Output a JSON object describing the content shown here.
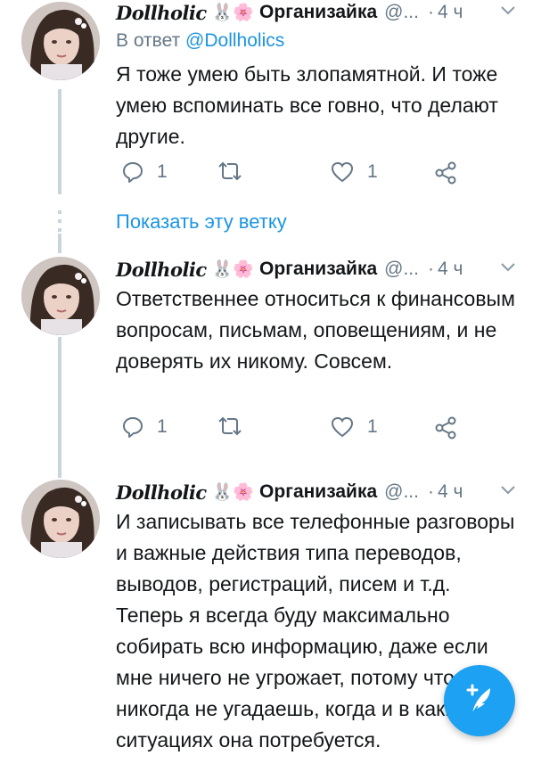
{
  "tweets": [
    {
      "author_name_script": "Dollholic",
      "author_emoji": "🐰🌸",
      "author_name": "Организайка",
      "handle": "@...",
      "dot": "·",
      "time": "4 ч",
      "reply_prefix": "В ответ ",
      "reply_handle": "@Dollholics",
      "text": "Я тоже умею быть злопамятной. И тоже умею вспоминать все говно, что делают другие.",
      "replies": "1",
      "retweets": "",
      "likes": "1"
    },
    {
      "author_name_script": "Dollholic",
      "author_emoji": "🐰🌸",
      "author_name": "Организайка",
      "handle": "@...",
      "dot": "·",
      "time": "4 ч",
      "text": "Ответственнее относиться к финансовым вопросам, письмам, оповещениям, и не доверять их никому. Совсем.",
      "replies": "1",
      "retweets": "",
      "likes": "1"
    },
    {
      "author_name_script": "Dollholic",
      "author_emoji": "🐰🌸",
      "author_name": "Организайка",
      "handle": "@...",
      "dot": "·",
      "time": "4 ч",
      "text": "И записывать все телефонные разговоры и важные действия типа переводов, выводов, регистраций, писем и т.д. Теперь я всегда буду максимально собирать всю информацию, даже если мне ничего не угрожает, потому что никогда не угадаешь, когда и в каких ситуациях она потребуется."
    }
  ],
  "show_thread_label": "Показать эту ветку",
  "icons": {
    "reply": "reply-icon",
    "retweet": "retweet-icon",
    "like": "heart-icon",
    "share": "share-icon",
    "caret": "chevron-down-icon",
    "compose": "compose-tweet-icon"
  },
  "colors": {
    "link": "#1b95e0",
    "muted": "#657786",
    "fab": "#1da1f2",
    "thread_line": "#c9d5dd"
  }
}
